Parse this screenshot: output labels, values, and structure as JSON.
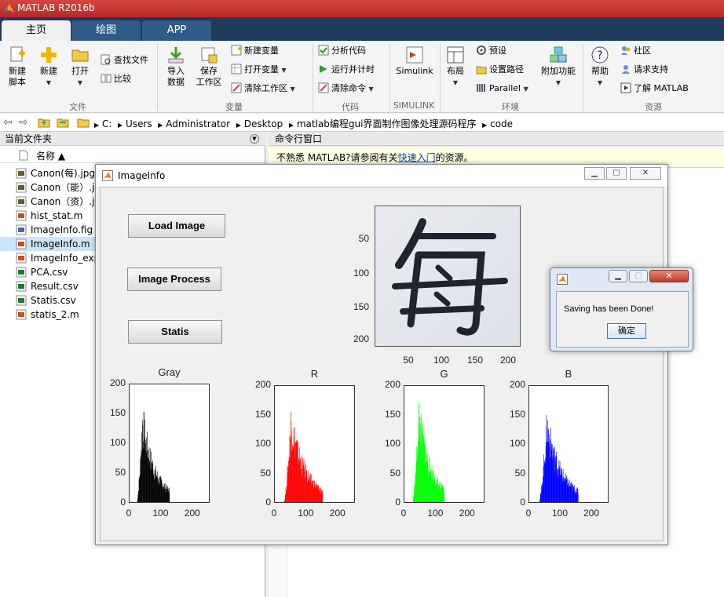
{
  "app": {
    "title": "MATLAB R2016b"
  },
  "tabs": [
    {
      "label": "主页"
    },
    {
      "label": "绘图"
    },
    {
      "label": "APP"
    }
  ],
  "ribbon": {
    "file": {
      "group": "文件",
      "new_script": "新建\n脚本",
      "new_script_l1": "新建",
      "new_script_l2": "脚本",
      "new": "新建",
      "open": "打开",
      "find_files": "查找文件",
      "compare": "比较"
    },
    "variable": {
      "group": "变量",
      "import_l1": "导入",
      "import_l2": "数据",
      "save_l1": "保存",
      "save_l2": "工作区",
      "new_var": "新建变量",
      "open_var": "打开变量",
      "clear_ws": "清除工作区"
    },
    "code": {
      "group": "代码",
      "analyze": "分析代码",
      "run_time": "运行并计时",
      "clear_cmd": "清除命令"
    },
    "simulink": {
      "group": "SIMULINK",
      "label": "Simulink"
    },
    "env": {
      "group": "环境",
      "layout": "布局",
      "prefs": "预设",
      "set_path": "设置路径",
      "parallel": "Parallel",
      "addons": "附加功能"
    },
    "resources": {
      "group": "资源",
      "help": "帮助",
      "community": "社区",
      "support": "请求支持",
      "learn": "了解 MATLAB"
    }
  },
  "address": {
    "crumbs": [
      "C:",
      "Users",
      "Administrator",
      "Desktop",
      "matlab编程gui界面制作图像处理源码程序",
      "code"
    ]
  },
  "files_panel": {
    "title": "当前文件夹",
    "col_name": "名称 ▲",
    "items": [
      {
        "name": "Canon(每).jpg",
        "type": "jpg"
      },
      {
        "name": "Canon（能）.jpg",
        "type": "jpg"
      },
      {
        "name": "Canon（资）.jpg",
        "type": "jpg"
      },
      {
        "name": "hist_stat.m",
        "type": "m"
      },
      {
        "name": "ImageInfo.fig",
        "type": "fig"
      },
      {
        "name": "ImageInfo.m",
        "type": "m"
      },
      {
        "name": "ImageInfo_export.m",
        "type": "m"
      },
      {
        "name": "PCA.csv",
        "type": "csv"
      },
      {
        "name": "Result.csv",
        "type": "csv"
      },
      {
        "name": "Statis.csv",
        "type": "csv"
      },
      {
        "name": "statis_2.m",
        "type": "m"
      }
    ]
  },
  "command_window": {
    "title": "命令行窗口",
    "info_prefix": "不熟悉 MATLAB?请参阅有关",
    "info_link": "快速入门",
    "info_suffix": "的资源。"
  },
  "figure": {
    "title": "ImageInfo",
    "buttons": {
      "load": "Load Image",
      "process": "Image Process",
      "statis": "Statis"
    },
    "image_axes": {
      "yticks": [
        "50",
        "100",
        "150",
        "200"
      ],
      "xticks": [
        "50",
        "100",
        "150",
        "200"
      ],
      "glyph": "每"
    }
  },
  "chart_data": [
    {
      "type": "bar",
      "title": "Gray",
      "color": "#000000",
      "ylim": [
        0,
        200
      ],
      "xlim": [
        0,
        255
      ],
      "yticks": [
        0,
        50,
        100,
        150,
        200
      ],
      "xticks": [
        0,
        100,
        200
      ],
      "peak": [
        40,
        165
      ],
      "end": 125
    },
    {
      "type": "bar",
      "title": "R",
      "color": "#ff0000",
      "ylim": [
        0,
        200
      ],
      "xlim": [
        0,
        255
      ],
      "yticks": [
        0,
        50,
        100,
        150,
        200
      ],
      "xticks": [
        0,
        100,
        200
      ],
      "peak": [
        50,
        165
      ],
      "end": 150
    },
    {
      "type": "bar",
      "title": "G",
      "color": "#00ff00",
      "ylim": [
        0,
        200
      ],
      "xlim": [
        0,
        255
      ],
      "yticks": [
        0,
        50,
        100,
        150,
        200
      ],
      "xticks": [
        0,
        100,
        200
      ],
      "peak": [
        45,
        180
      ],
      "end": 125
    },
    {
      "type": "bar",
      "title": "B",
      "color": "#0000ff",
      "ylim": [
        0,
        200
      ],
      "xlim": [
        0,
        255
      ],
      "yticks": [
        0,
        50,
        100,
        150,
        200
      ],
      "xticks": [
        0,
        100,
        200
      ],
      "peak": [
        55,
        160
      ],
      "end": 155
    }
  ],
  "dialog": {
    "message": "Saving has been Done!",
    "ok": "确定"
  }
}
